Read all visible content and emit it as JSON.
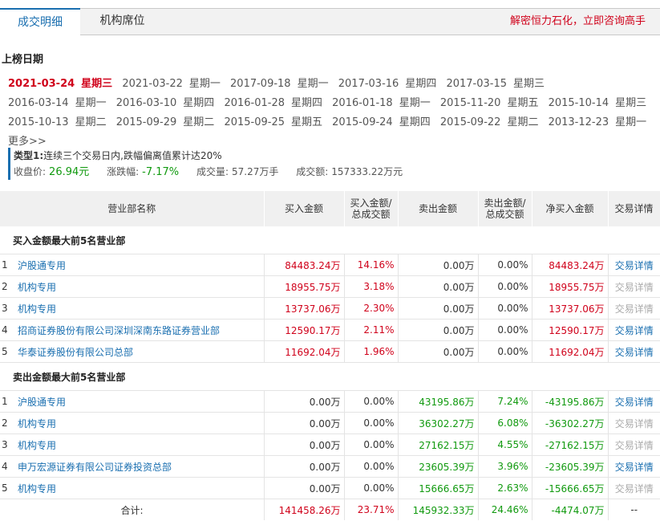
{
  "tabs": [
    "成交明细",
    "机构席位"
  ],
  "promo_link": "解密恒力石化，立即咨询高手",
  "date_heading": "上榜日期",
  "dates": [
    {
      "date": "2021-03-24",
      "week": "星期三",
      "current": true
    },
    {
      "date": "2021-03-22",
      "week": "星期一"
    },
    {
      "date": "2017-09-18",
      "week": "星期一"
    },
    {
      "date": "2017-03-16",
      "week": "星期四"
    },
    {
      "date": "2017-03-15",
      "week": "星期三"
    },
    {
      "date": "2016-03-14",
      "week": "星期一"
    },
    {
      "date": "2016-03-10",
      "week": "星期四"
    },
    {
      "date": "2016-01-28",
      "week": "星期四"
    },
    {
      "date": "2016-01-18",
      "week": "星期一"
    },
    {
      "date": "2015-11-20",
      "week": "星期五"
    },
    {
      "date": "2015-10-14",
      "week": "星期三"
    },
    {
      "date": "2015-10-13",
      "week": "星期二"
    },
    {
      "date": "2015-09-29",
      "week": "星期二"
    },
    {
      "date": "2015-09-25",
      "week": "星期五"
    },
    {
      "date": "2015-09-24",
      "week": "星期四"
    },
    {
      "date": "2015-09-22",
      "week": "星期二"
    },
    {
      "date": "2013-12-23",
      "week": "星期一"
    }
  ],
  "more_label": "更多>>",
  "type_label": "类型1:",
  "type_desc": "连续三个交易日内,跌幅偏离值累计达20%",
  "stats": {
    "close_label": "收盘价:",
    "close": "26.94元",
    "change_label": "涨跌幅:",
    "change": "-7.17%",
    "volume_label": "成交量:",
    "volume": "57.27万手",
    "amount_label": "成交额:",
    "amount": "157333.22万元"
  },
  "headers": [
    "营业部名称",
    "买入金额",
    "买入金额/\n总成交额",
    "卖出金额",
    "卖出金额/\n总成交额",
    "净买入金额",
    "交易详情"
  ],
  "buy_section": "买入金额最大前5名营业部",
  "sell_section": "卖出金额最大前5名营业部",
  "buy_rows": [
    {
      "idx": "1",
      "name": "沪股通专用",
      "buy": "84483.24万",
      "buy_pct": "14.16%",
      "sell": "0.00万",
      "sell_pct": "0.00%",
      "net": "84483.24万",
      "detail": "交易详情",
      "active": true
    },
    {
      "idx": "2",
      "name": "机构专用",
      "buy": "18955.75万",
      "buy_pct": "3.18%",
      "sell": "0.00万",
      "sell_pct": "0.00%",
      "net": "18955.75万",
      "detail": "交易详情",
      "active": false
    },
    {
      "idx": "3",
      "name": "机构专用",
      "buy": "13737.06万",
      "buy_pct": "2.30%",
      "sell": "0.00万",
      "sell_pct": "0.00%",
      "net": "13737.06万",
      "detail": "交易详情",
      "active": false
    },
    {
      "idx": "4",
      "name": "招商证券股份有限公司深圳深南东路证券营业部",
      "buy": "12590.17万",
      "buy_pct": "2.11%",
      "sell": "0.00万",
      "sell_pct": "0.00%",
      "net": "12590.17万",
      "detail": "交易详情",
      "active": true
    },
    {
      "idx": "5",
      "name": "华泰证券股份有限公司总部",
      "buy": "11692.04万",
      "buy_pct": "1.96%",
      "sell": "0.00万",
      "sell_pct": "0.00%",
      "net": "11692.04万",
      "detail": "交易详情",
      "active": true
    }
  ],
  "sell_rows": [
    {
      "idx": "1",
      "name": "沪股通专用",
      "buy": "0.00万",
      "buy_pct": "0.00%",
      "sell": "43195.86万",
      "sell_pct": "7.24%",
      "net": "-43195.86万",
      "detail": "交易详情",
      "active": true
    },
    {
      "idx": "2",
      "name": "机构专用",
      "buy": "0.00万",
      "buy_pct": "0.00%",
      "sell": "36302.27万",
      "sell_pct": "6.08%",
      "net": "-36302.27万",
      "detail": "交易详情",
      "active": false
    },
    {
      "idx": "3",
      "name": "机构专用",
      "buy": "0.00万",
      "buy_pct": "0.00%",
      "sell": "27162.15万",
      "sell_pct": "4.55%",
      "net": "-27162.15万",
      "detail": "交易详情",
      "active": false
    },
    {
      "idx": "4",
      "name": "申万宏源证券有限公司证券投资总部",
      "buy": "0.00万",
      "buy_pct": "0.00%",
      "sell": "23605.39万",
      "sell_pct": "3.96%",
      "net": "-23605.39万",
      "detail": "交易详情",
      "active": true
    },
    {
      "idx": "5",
      "name": "机构专用",
      "buy": "0.00万",
      "buy_pct": "0.00%",
      "sell": "15666.65万",
      "sell_pct": "2.63%",
      "net": "-15666.65万",
      "detail": "交易详情",
      "active": false
    }
  ],
  "total": {
    "label": "合计:",
    "buy": "141458.26万",
    "buy_pct": "23.71%",
    "sell": "145932.33万",
    "sell_pct": "24.46%",
    "net": "-4474.07万",
    "detail": "--"
  },
  "colors": {
    "accent": "#1a6fb0",
    "up": "#d0021b",
    "down": "#119a0f"
  }
}
